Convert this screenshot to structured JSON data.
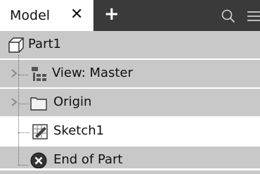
{
  "tabbar": {
    "tab_label": "Model",
    "close_glyph": "✕",
    "add_glyph": "+",
    "search_icon": "search-icon",
    "menu_icon": "menu-icon"
  },
  "tree": {
    "items": [
      {
        "label": "Part1",
        "icon": "part-icon",
        "expandable": false,
        "selected": true
      },
      {
        "label": "View: Master",
        "icon": "view-rep-icon",
        "expandable": true,
        "selected": true
      },
      {
        "label": "Origin",
        "icon": "folder-icon",
        "expandable": true,
        "selected": true
      },
      {
        "label": "Sketch1",
        "icon": "sketch-icon",
        "expandable": false,
        "selected": false
      },
      {
        "label": "End of Part",
        "icon": "end-of-part-icon",
        "expandable": false,
        "selected": true
      }
    ]
  },
  "colors": {
    "tabbar_bg": "#3a3a3a",
    "selected_row_bg": "#c8c8c8",
    "end_of_part_icon": "#333333"
  }
}
